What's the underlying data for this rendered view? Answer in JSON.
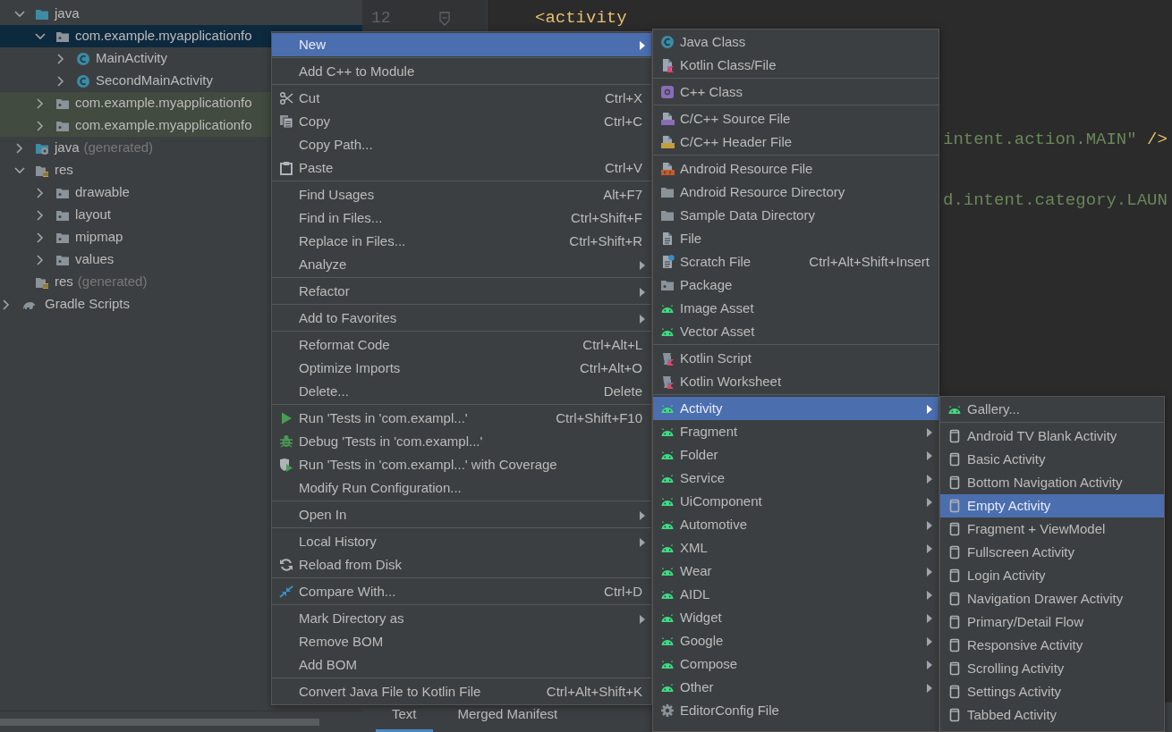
{
  "project_tree": {
    "module_children": [
      {
        "label": "java",
        "kind": "source-folder",
        "expanded": true,
        "selected": false,
        "test_scope": false,
        "children": [
          {
            "label": "com.example.myapplicationfo",
            "kind": "package",
            "expanded": true,
            "selected": true,
            "test_scope": false,
            "children": [
              {
                "label": "MainActivity",
                "kind": "java-class",
                "expanded": false,
                "selected": false,
                "test_scope": false
              },
              {
                "label": "SecondMainActivity",
                "kind": "java-class",
                "expanded": false,
                "selected": false,
                "test_scope": false
              }
            ]
          },
          {
            "label": "com.example.myapplicationfo",
            "kind": "package",
            "expanded": false,
            "selected": false,
            "test_scope": true
          },
          {
            "label": "com.example.myapplicationfo",
            "kind": "package",
            "expanded": false,
            "selected": false,
            "test_scope": true
          }
        ]
      },
      {
        "label": "java",
        "note": "(generated)",
        "kind": "generated-folder",
        "expanded": false,
        "selected": false,
        "test_scope": false
      },
      {
        "label": "res",
        "kind": "res-folder",
        "expanded": true,
        "selected": false,
        "test_scope": false,
        "children": [
          {
            "label": "drawable",
            "kind": "package",
            "expanded": false,
            "selected": false,
            "test_scope": false
          },
          {
            "label": "layout",
            "kind": "package",
            "expanded": false,
            "selected": false,
            "test_scope": false
          },
          {
            "label": "mipmap",
            "kind": "package",
            "expanded": false,
            "selected": false,
            "test_scope": false
          },
          {
            "label": "values",
            "kind": "package",
            "expanded": false,
            "selected": false,
            "test_scope": false
          }
        ]
      },
      {
        "label": "res",
        "note": "(generated)",
        "kind": "res-folder",
        "selected": false,
        "test_scope": false
      }
    ],
    "root_items": [
      {
        "label": "Gradle Scripts",
        "kind": "gradle",
        "expanded": false,
        "selected": false,
        "test_scope": false
      }
    ]
  },
  "editor": {
    "lines": [
      {
        "kind": "tag",
        "number": "12",
        "text": "<activity"
      },
      {
        "kind": "blank"
      },
      {
        "kind": "blank"
      },
      {
        "kind": "blank"
      },
      {
        "kind": "value",
        "text": "intent.action.MAIN\"",
        "tail": " />"
      },
      {
        "kind": "blank"
      },
      {
        "kind": "value",
        "text": "d.intent.category.LAUN"
      }
    ],
    "bottom_tabs": [
      {
        "label": "Text",
        "selected": true
      },
      {
        "label": "Merged Manifest",
        "selected": false
      }
    ]
  },
  "context_menu": {
    "groups": [
      {
        "items": [
          {
            "label": "New",
            "kind": "plain",
            "submenu": true,
            "selected": true
          }
        ]
      },
      {
        "items": [
          {
            "label": "Add C++ to Module",
            "kind": "plain",
            "submenu": false,
            "selected": false
          }
        ]
      },
      {
        "items": [
          {
            "label": "Cut",
            "kind": "scissors",
            "shortcut": "Ctrl+X",
            "submenu": false,
            "selected": false
          },
          {
            "label": "Copy",
            "kind": "copy",
            "shortcut": "Ctrl+C",
            "submenu": false,
            "selected": false
          },
          {
            "label": "Copy Path...",
            "kind": "plain",
            "submenu": false,
            "selected": false
          },
          {
            "label": "Paste",
            "kind": "paste",
            "shortcut": "Ctrl+V",
            "submenu": false,
            "selected": false
          }
        ]
      },
      {
        "items": [
          {
            "label": "Find Usages",
            "kind": "plain",
            "shortcut": "Alt+F7",
            "submenu": false,
            "selected": false
          },
          {
            "label": "Find in Files...",
            "kind": "plain",
            "shortcut": "Ctrl+Shift+F",
            "submenu": false,
            "selected": false
          },
          {
            "label": "Replace in Files...",
            "kind": "plain",
            "shortcut": "Ctrl+Shift+R",
            "submenu": false,
            "selected": false
          },
          {
            "label": "Analyze",
            "kind": "plain",
            "submenu": true,
            "selected": false
          }
        ]
      },
      {
        "items": [
          {
            "label": "Refactor",
            "kind": "plain",
            "submenu": true,
            "selected": false
          }
        ]
      },
      {
        "items": [
          {
            "label": "Add to Favorites",
            "kind": "plain",
            "submenu": true,
            "selected": false
          }
        ]
      },
      {
        "items": [
          {
            "label": "Reformat Code",
            "kind": "plain",
            "shortcut": "Ctrl+Alt+L",
            "submenu": false,
            "selected": false
          },
          {
            "label": "Optimize Imports",
            "kind": "plain",
            "shortcut": "Ctrl+Alt+O",
            "submenu": false,
            "selected": false
          },
          {
            "label": "Delete...",
            "kind": "plain",
            "shortcut": "Delete",
            "submenu": false,
            "selected": false
          }
        ]
      },
      {
        "items": [
          {
            "label": "Run 'Tests in 'com.exampl...'",
            "kind": "run",
            "shortcut": "Ctrl+Shift+F10",
            "submenu": false,
            "selected": false
          },
          {
            "label": "Debug 'Tests in 'com.exampl...'",
            "kind": "debug",
            "submenu": false,
            "selected": false
          },
          {
            "label": "Run 'Tests in 'com.exampl...' with Coverage",
            "kind": "coverage",
            "submenu": false,
            "selected": false
          },
          {
            "label": "Modify Run Configuration...",
            "kind": "plain",
            "submenu": false,
            "selected": false
          }
        ]
      },
      {
        "items": [
          {
            "label": "Open In",
            "kind": "plain",
            "submenu": true,
            "selected": false
          }
        ]
      },
      {
        "items": [
          {
            "label": "Local History",
            "kind": "plain",
            "submenu": true,
            "selected": false
          },
          {
            "label": "Reload from Disk",
            "kind": "reload",
            "submenu": false,
            "selected": false
          }
        ]
      },
      {
        "items": [
          {
            "label": "Compare With...",
            "kind": "compare",
            "shortcut": "Ctrl+D",
            "submenu": false,
            "selected": false
          }
        ]
      },
      {
        "items": [
          {
            "label": "Mark Directory as",
            "kind": "plain",
            "submenu": true,
            "selected": false
          },
          {
            "label": "Remove BOM",
            "kind": "plain",
            "submenu": false,
            "selected": false
          },
          {
            "label": "Add BOM",
            "kind": "plain",
            "submenu": false,
            "selected": false
          }
        ]
      },
      {
        "items": [
          {
            "label": "Convert Java File to Kotlin File",
            "kind": "plain",
            "shortcut": "Ctrl+Alt+Shift+K",
            "submenu": false,
            "selected": false
          }
        ]
      }
    ]
  },
  "new_submenu": {
    "groups": [
      {
        "items": [
          {
            "label": "Java Class",
            "kind": "java-class",
            "submenu": false,
            "selected": false
          },
          {
            "label": "Kotlin Class/File",
            "kind": "kotlin-file",
            "submenu": false,
            "selected": false
          }
        ]
      },
      {
        "items": [
          {
            "label": "C++ Class",
            "kind": "cpp-class",
            "submenu": false,
            "selected": false
          }
        ]
      },
      {
        "items": [
          {
            "label": "C/C++ Source File",
            "kind": "cpp-source",
            "submenu": false,
            "selected": false
          },
          {
            "label": "C/C++ Header File",
            "kind": "cpp-header",
            "submenu": false,
            "selected": false
          }
        ]
      },
      {
        "items": [
          {
            "label": "Android Resource File",
            "kind": "resource-file",
            "submenu": false,
            "selected": false
          },
          {
            "label": "Android Resource Directory",
            "kind": "folder",
            "submenu": false,
            "selected": false
          },
          {
            "label": "Sample Data Directory",
            "kind": "folder",
            "submenu": false,
            "selected": false
          },
          {
            "label": "File",
            "kind": "file",
            "submenu": false,
            "selected": false
          },
          {
            "label": "Scratch File",
            "kind": "scratch-file",
            "shortcut": "Ctrl+Alt+Shift+Insert",
            "submenu": false,
            "selected": false
          },
          {
            "label": "Package",
            "kind": "package",
            "submenu": false,
            "selected": false
          },
          {
            "label": "Image Asset",
            "kind": "android",
            "submenu": false,
            "selected": false
          },
          {
            "label": "Vector Asset",
            "kind": "android",
            "submenu": false,
            "selected": false
          }
        ]
      },
      {
        "items": [
          {
            "label": "Kotlin Script",
            "kind": "kotlin-script",
            "submenu": false,
            "selected": false
          },
          {
            "label": "Kotlin Worksheet",
            "kind": "kotlin-script",
            "submenu": false,
            "selected": false
          }
        ]
      },
      {
        "items": [
          {
            "label": "Activity",
            "kind": "android",
            "submenu": true,
            "selected": true
          },
          {
            "label": "Fragment",
            "kind": "android",
            "submenu": true,
            "selected": false
          },
          {
            "label": "Folder",
            "kind": "android",
            "submenu": true,
            "selected": false
          },
          {
            "label": "Service",
            "kind": "android",
            "submenu": true,
            "selected": false
          },
          {
            "label": "UiComponent",
            "kind": "android",
            "submenu": true,
            "selected": false
          },
          {
            "label": "Automotive",
            "kind": "android",
            "submenu": true,
            "selected": false
          },
          {
            "label": "XML",
            "kind": "android",
            "submenu": true,
            "selected": false
          },
          {
            "label": "Wear",
            "kind": "android",
            "submenu": true,
            "selected": false
          },
          {
            "label": "AIDL",
            "kind": "android",
            "submenu": true,
            "selected": false
          },
          {
            "label": "Widget",
            "kind": "android",
            "submenu": true,
            "selected": false
          },
          {
            "label": "Google",
            "kind": "android",
            "submenu": true,
            "selected": false
          },
          {
            "label": "Compose",
            "kind": "android",
            "submenu": true,
            "selected": false
          },
          {
            "label": "Other",
            "kind": "android",
            "submenu": true,
            "selected": false
          },
          {
            "label": "EditorConfig File",
            "kind": "gear",
            "submenu": false,
            "selected": false
          }
        ]
      }
    ]
  },
  "activity_submenu": {
    "groups": [
      {
        "items": [
          {
            "label": "Gallery...",
            "kind": "android",
            "submenu": false,
            "selected": false
          }
        ]
      },
      {
        "items": [
          {
            "label": "Android TV Blank Activity",
            "kind": "phone",
            "submenu": false,
            "selected": false
          },
          {
            "label": "Basic Activity",
            "kind": "phone",
            "submenu": false,
            "selected": false
          },
          {
            "label": "Bottom Navigation Activity",
            "kind": "phone",
            "submenu": false,
            "selected": false
          },
          {
            "label": "Empty Activity",
            "kind": "phone",
            "submenu": false,
            "selected": true
          },
          {
            "label": "Fragment + ViewModel",
            "kind": "phone",
            "submenu": false,
            "selected": false
          },
          {
            "label": "Fullscreen Activity",
            "kind": "phone",
            "submenu": false,
            "selected": false
          },
          {
            "label": "Login Activity",
            "kind": "phone",
            "submenu": false,
            "selected": false
          },
          {
            "label": "Navigation Drawer Activity",
            "kind": "phone",
            "submenu": false,
            "selected": false
          },
          {
            "label": "Primary/Detail Flow",
            "kind": "phone",
            "submenu": false,
            "selected": false
          },
          {
            "label": "Responsive Activity",
            "kind": "phone",
            "submenu": false,
            "selected": false
          },
          {
            "label": "Scrolling Activity",
            "kind": "phone",
            "submenu": false,
            "selected": false
          },
          {
            "label": "Settings Activity",
            "kind": "phone",
            "submenu": false,
            "selected": false
          },
          {
            "label": "Tabbed Activity",
            "kind": "phone",
            "submenu": false,
            "selected": false
          }
        ]
      }
    ]
  }
}
